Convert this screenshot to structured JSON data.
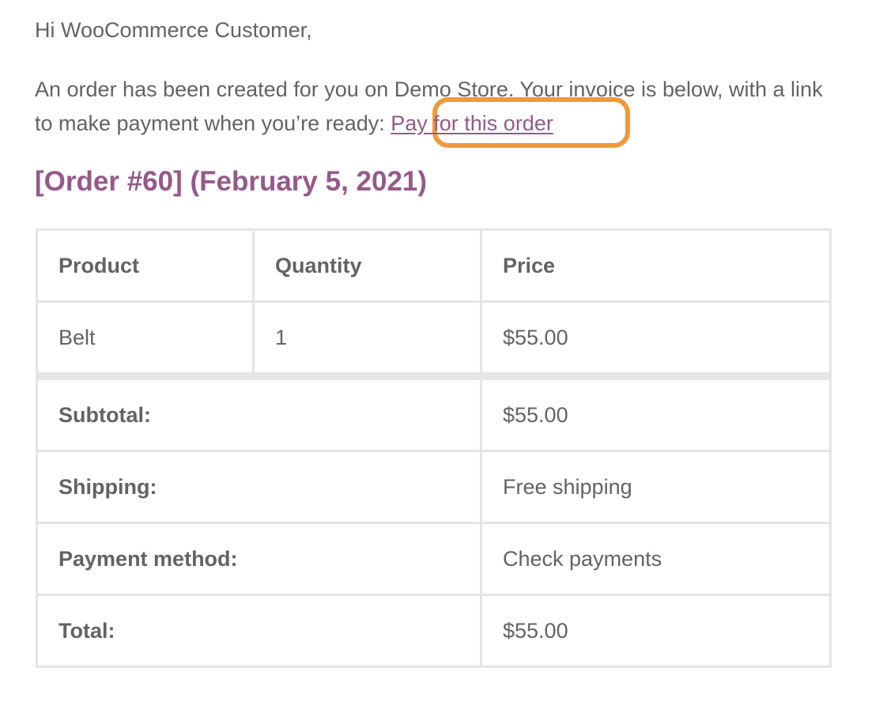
{
  "email": {
    "greeting": "Hi WooCommerce Customer,",
    "intro_text": "An order has been created for you on Demo Store. Your invoice is below, with a link to make payment when you’re ready:",
    "pay_link_label": "Pay for this order",
    "order_heading": "[Order #60] (February 5, 2021)"
  },
  "table": {
    "headers": {
      "product": "Product",
      "quantity": "Quantity",
      "price": "Price"
    },
    "items": [
      {
        "product": "Belt",
        "quantity": "1",
        "price": "$55.00"
      }
    ],
    "totals": [
      {
        "label": "Subtotal:",
        "value": "$55.00"
      },
      {
        "label": "Shipping:",
        "value": "Free shipping"
      },
      {
        "label": "Payment method:",
        "value": "Check payments"
      },
      {
        "label": "Total:",
        "value": "$55.00"
      }
    ]
  },
  "colors": {
    "link": "#96588a",
    "text": "#636363",
    "border": "#e5e5e5",
    "highlight": "#f1993a"
  }
}
